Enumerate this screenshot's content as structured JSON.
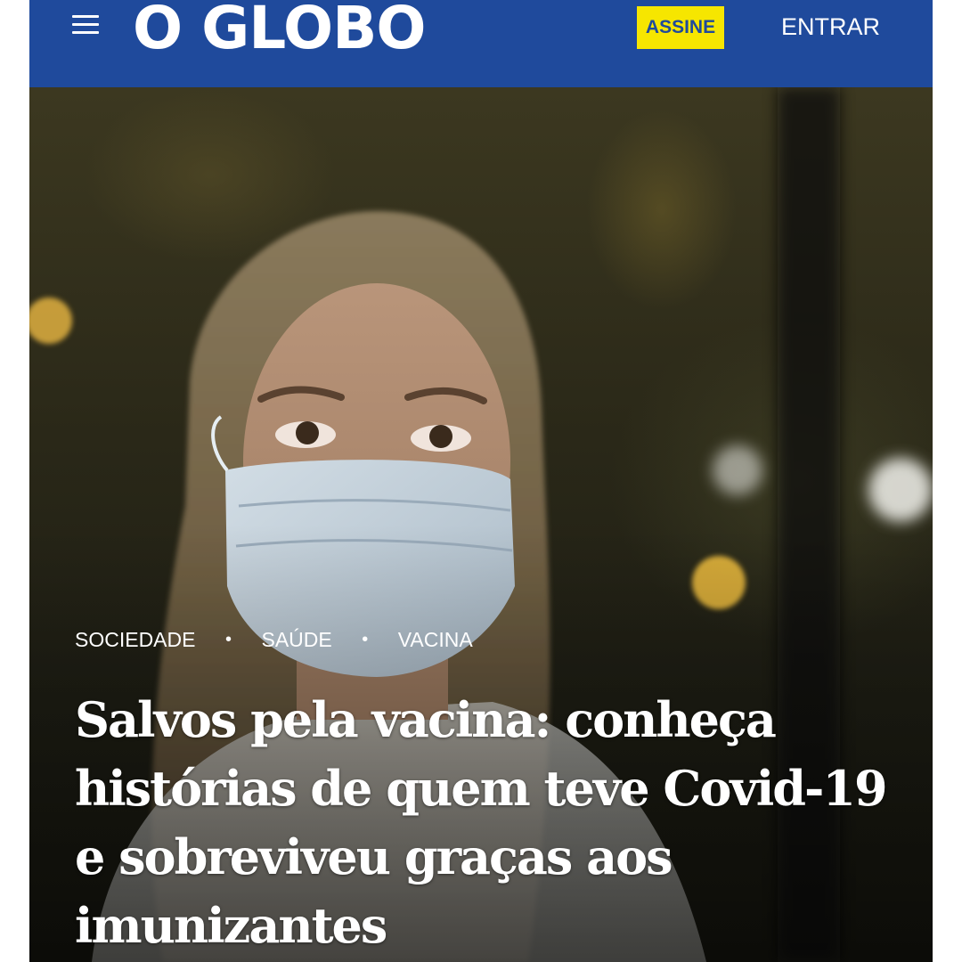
{
  "header": {
    "logo_text": "O GLOBO",
    "subscribe_label": "ASSINE",
    "login_label": "ENTRAR",
    "brand_color": "#1f4a9c",
    "subscribe_color": "#f6e600",
    "menu_icon": "hamburger-menu-icon"
  },
  "article": {
    "tags": [
      "SOCIEDADE",
      "SAÚDE",
      "VACINA"
    ],
    "tag_separator": "•",
    "headline": "Salvos pela vacina: conheça histórias de quem teve Covid-19 e sobreviveu graças aos imunizantes"
  }
}
